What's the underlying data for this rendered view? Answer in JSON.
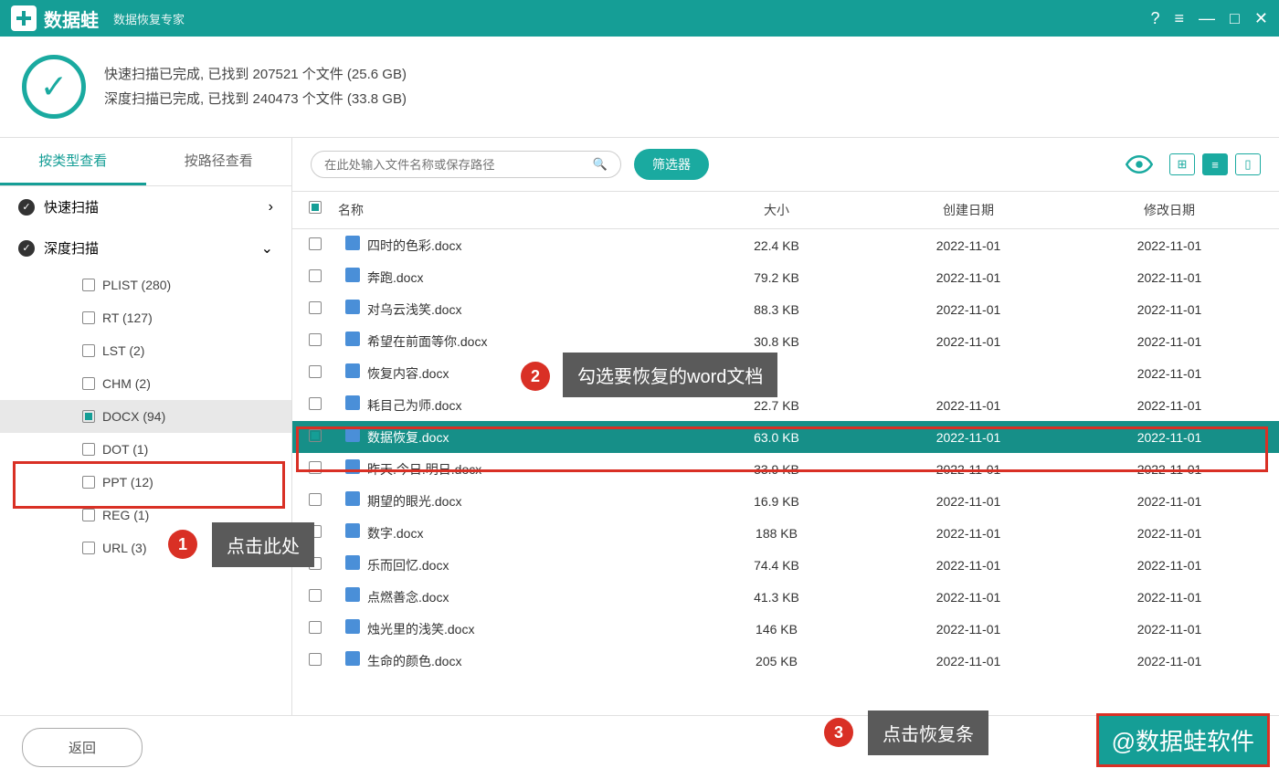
{
  "titlebar": {
    "app": "数据蛙",
    "subtitle": "数据恢复专家"
  },
  "summary": {
    "line1_a": "快速扫描已完成, 已找到 ",
    "line1_b": "207521",
    "line1_c": " 个文件 (25.6 GB)",
    "line2_a": "深度扫描已完成, 已找到 ",
    "line2_b": "240473",
    "line2_c": " 个文件 (33.8 GB)"
  },
  "sidebar": {
    "tabs": [
      "按类型查看",
      "按路径查看"
    ],
    "groups": [
      {
        "label": "快速扫描",
        "chev": "›"
      },
      {
        "label": "深度扫描",
        "chev": "⌄"
      }
    ],
    "items": [
      {
        "label": "PLIST (280)"
      },
      {
        "label": "RT (127)"
      },
      {
        "label": "LST (2)"
      },
      {
        "label": "CHM (2)"
      },
      {
        "label": "DOCX (94)",
        "selected": true
      },
      {
        "label": "DOT (1)"
      },
      {
        "label": "PPT (12)"
      },
      {
        "label": "REG (1)"
      },
      {
        "label": "URL (3)"
      }
    ]
  },
  "toolbar": {
    "search_placeholder": "在此处输入文件名称或保存路径",
    "filter": "筛选器"
  },
  "table": {
    "headers": [
      "名称",
      "大小",
      "创建日期",
      "修改日期"
    ]
  },
  "rows": [
    {
      "name": "四时的色彩.docx",
      "size": "22.4 KB",
      "cd": "2022-11-01",
      "md": "2022-11-01"
    },
    {
      "name": "奔跑.docx",
      "size": "79.2 KB",
      "cd": "2022-11-01",
      "md": "2022-11-01"
    },
    {
      "name": "对乌云浅笑.docx",
      "size": "88.3 KB",
      "cd": "2022-11-01",
      "md": "2022-11-01"
    },
    {
      "name": "希望在前面等你.docx",
      "size": "30.8 KB",
      "cd": "2022-11-01",
      "md": "2022-11-01"
    },
    {
      "name": "恢复内容.docx",
      "size": "",
      "cd": "",
      "md": "2022-11-01"
    },
    {
      "name": "耗目己为师.docx",
      "size": "22.7 KB",
      "cd": "2022-11-01",
      "md": "2022-11-01"
    },
    {
      "name": "数据恢复.docx",
      "size": "63.0 KB",
      "cd": "2022-11-01",
      "md": "2022-11-01",
      "selected": true
    },
    {
      "name": "昨天.今日.明日.docx",
      "size": "33.9 KB",
      "cd": "2022-11-01",
      "md": "2022-11-01"
    },
    {
      "name": "期望的眼光.docx",
      "size": "16.9 KB",
      "cd": "2022-11-01",
      "md": "2022-11-01"
    },
    {
      "name": "数字.docx",
      "size": "188 KB",
      "cd": "2022-11-01",
      "md": "2022-11-01"
    },
    {
      "name": "乐而回忆.docx",
      "size": "74.4 KB",
      "cd": "2022-11-01",
      "md": "2022-11-01"
    },
    {
      "name": "点燃善念.docx",
      "size": "41.3 KB",
      "cd": "2022-11-01",
      "md": "2022-11-01"
    },
    {
      "name": "烛光里的浅笑.docx",
      "size": "146 KB",
      "cd": "2022-11-01",
      "md": "2022-11-01"
    },
    {
      "name": "生命的颜色.docx",
      "size": "205 KB",
      "cd": "2022-11-01",
      "md": "2022-11-01"
    }
  ],
  "footer": {
    "back": "返回"
  },
  "annotations": {
    "a1": "点击此处",
    "a2": "勾选要恢复的word文档",
    "a3": "点击恢复条",
    "wm": "@数据蛙软件"
  }
}
